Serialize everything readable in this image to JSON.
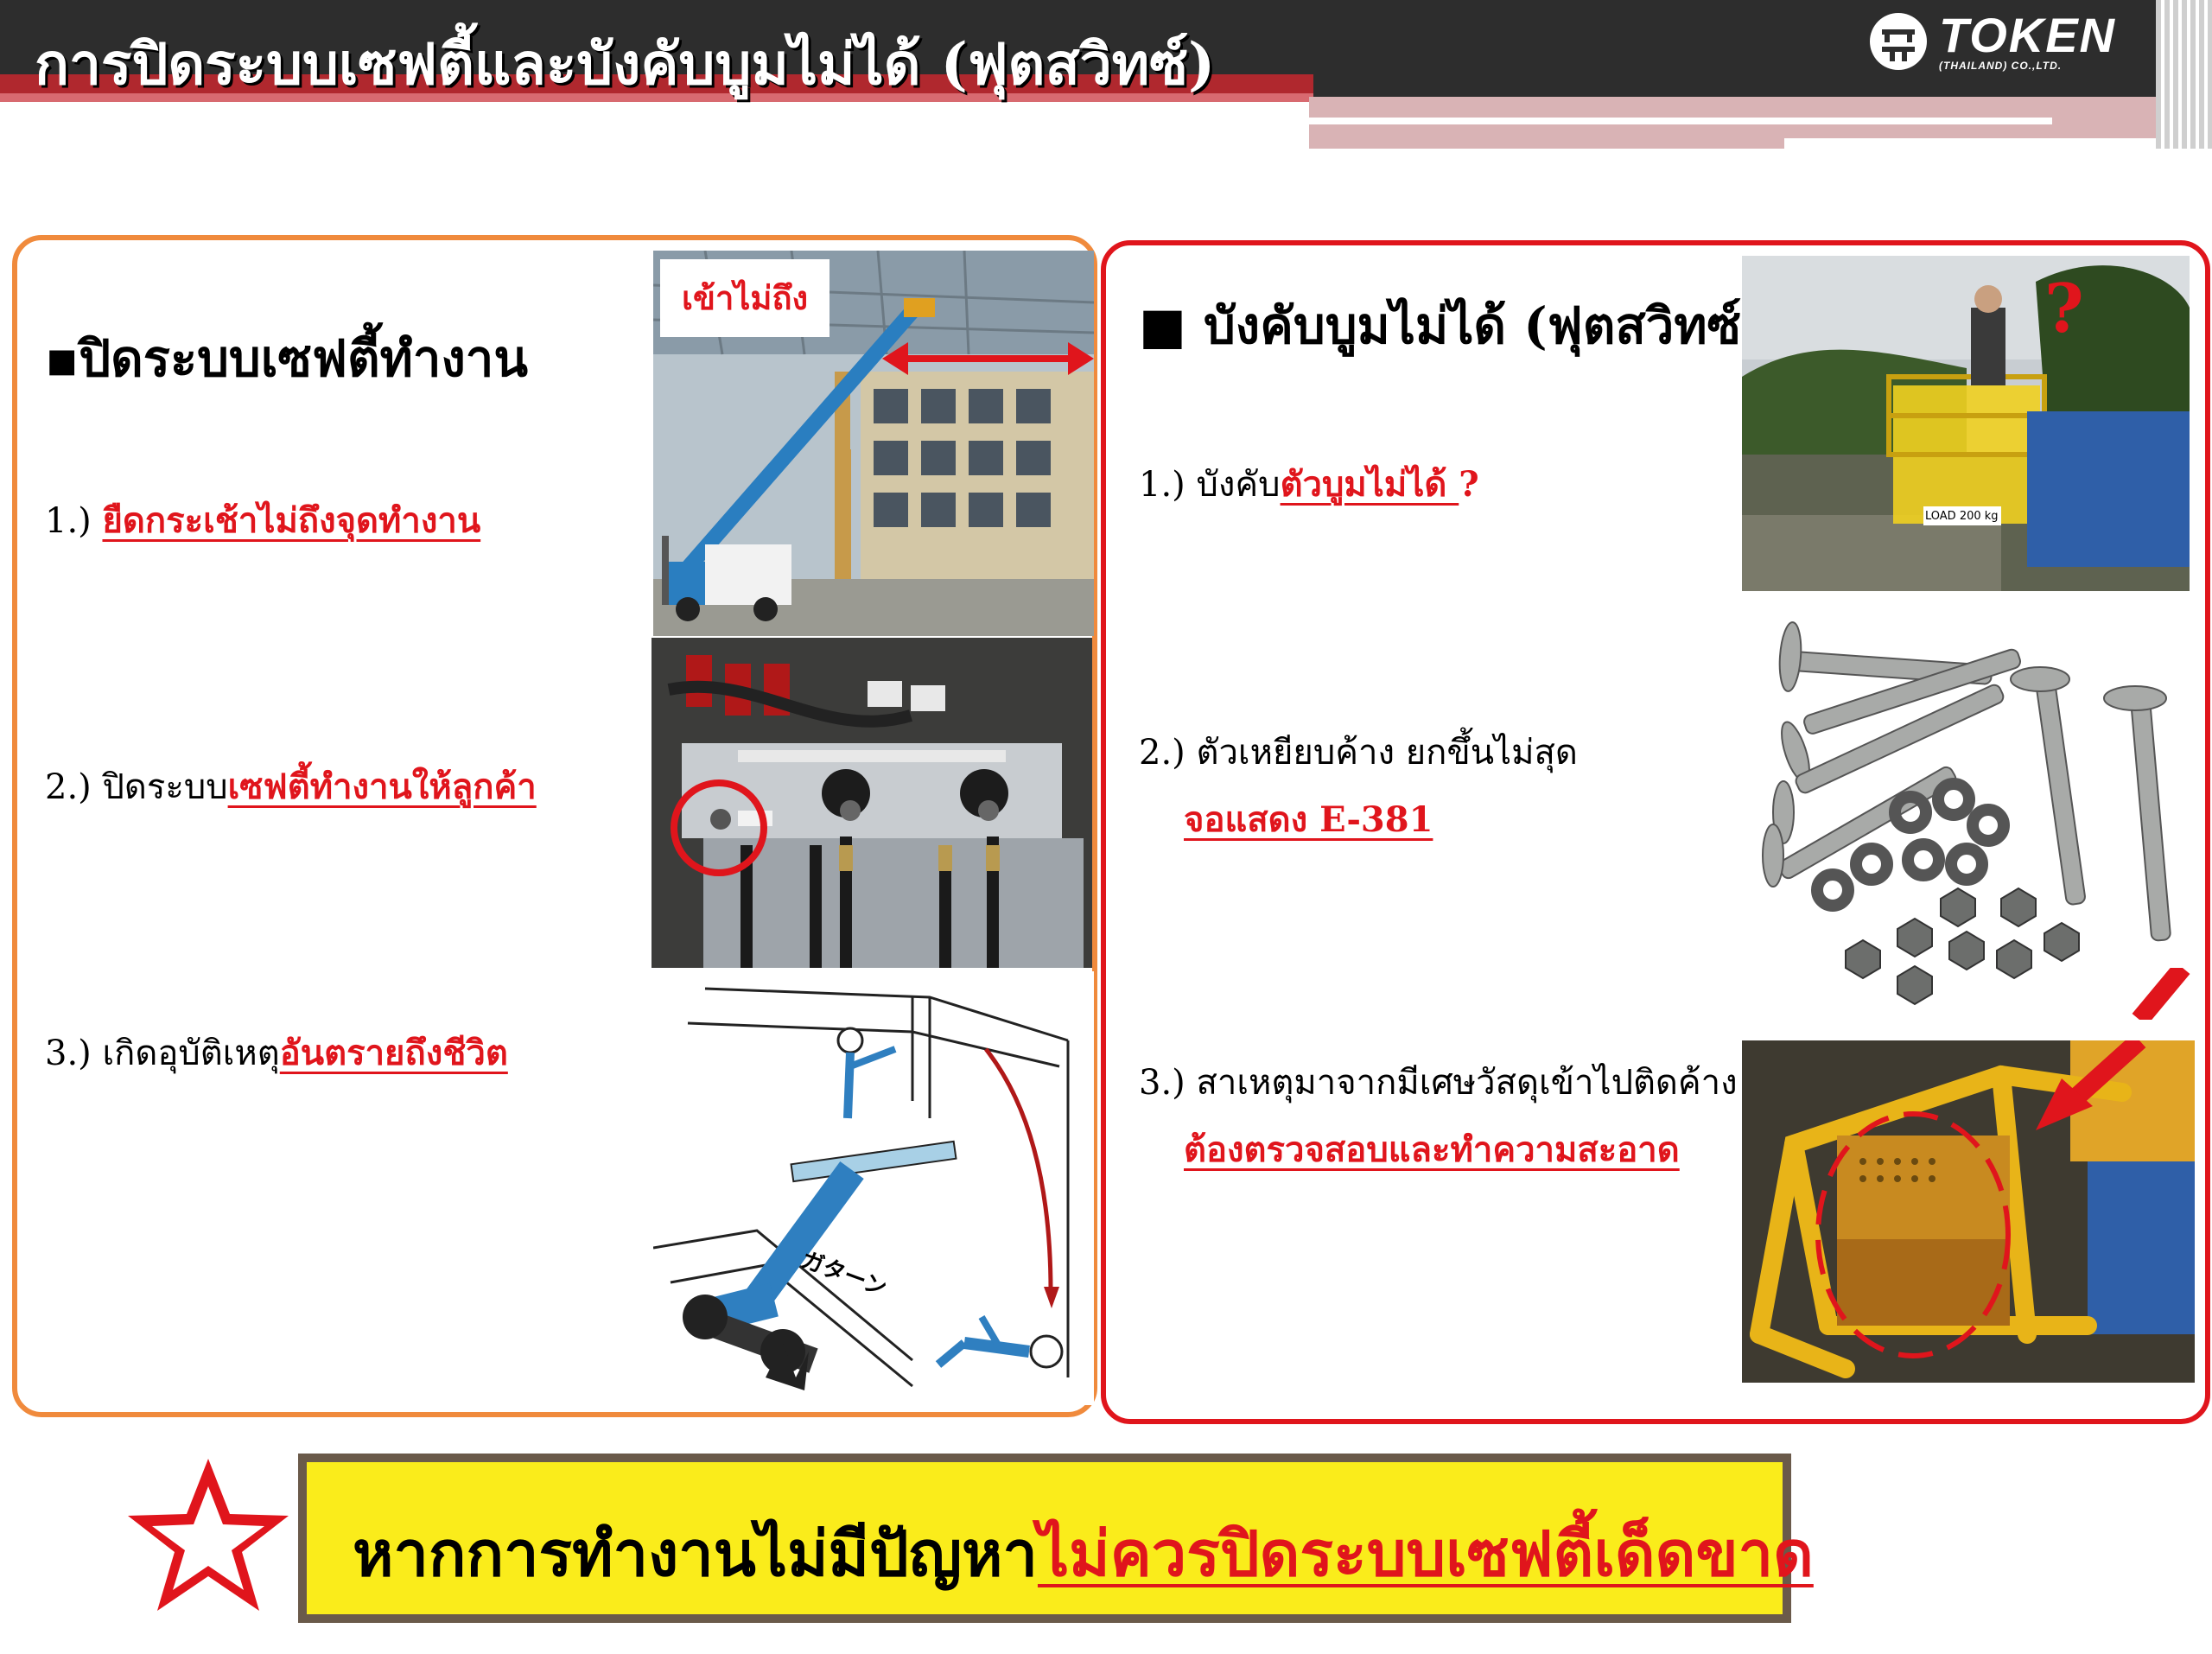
{
  "header": {
    "title": "การปิดระบบเซฟตี้และบังคับบูมไม่ได้ (ฟุตสวิทซ์)",
    "logo_text": "TOKEN",
    "logo_sub": "(THAILAND) CO.,LTD."
  },
  "left": {
    "heading": "▪ปิดระบบเซฟตี้ทำงาน",
    "items": [
      {
        "prefix": "1.) ",
        "highlight": "ยืดกระเช้าไม่ถึงจุดทำงาน"
      },
      {
        "prefix": "2.) ปิดระบบ",
        "highlight": "เซฟตี้ทำงานให้ลูกค้า"
      },
      {
        "prefix": "3.) เกิดอุบัติเหตุ",
        "highlight": "อันตรายถึงชีวิต"
      }
    ],
    "photo_label": "เข้าไม่ถึง",
    "illustration_label": "ガターン"
  },
  "right": {
    "heading": "■ บังคับบูมไม่ได้ (ฟุตสวิทซ์)",
    "items": [
      {
        "prefix": "1.) บังคับ",
        "highlight": "ตัวบูมไม่ได้ ",
        "suffix": "?",
        "line2": ""
      },
      {
        "prefix": "2.) ตัวเหยียบค้าง ยกขึ้นไม่สุด",
        "highlight": "",
        "suffix": "",
        "line2": "จอแสดง E-381"
      },
      {
        "prefix": "3.) สาเหตุมาจากมีเศษวัสดุเข้าไปติดค้าง",
        "highlight": "",
        "suffix": "",
        "line2": "ต้องตรวจสอบและทำความสะอาด"
      }
    ],
    "question_mark": "?",
    "basket_label": "LOAD 200 kg"
  },
  "banner": {
    "prefix": "หากการทำงานไม่มีปัญหา",
    "highlight": "ไม่ควรปิดระบบเซฟตี้เด็ดขาด"
  },
  "colors": {
    "accent_red": "#e0151c",
    "accent_orange": "#f08a3c",
    "banner_yellow": "#faec1b",
    "header_dark": "#2d2d2d"
  }
}
